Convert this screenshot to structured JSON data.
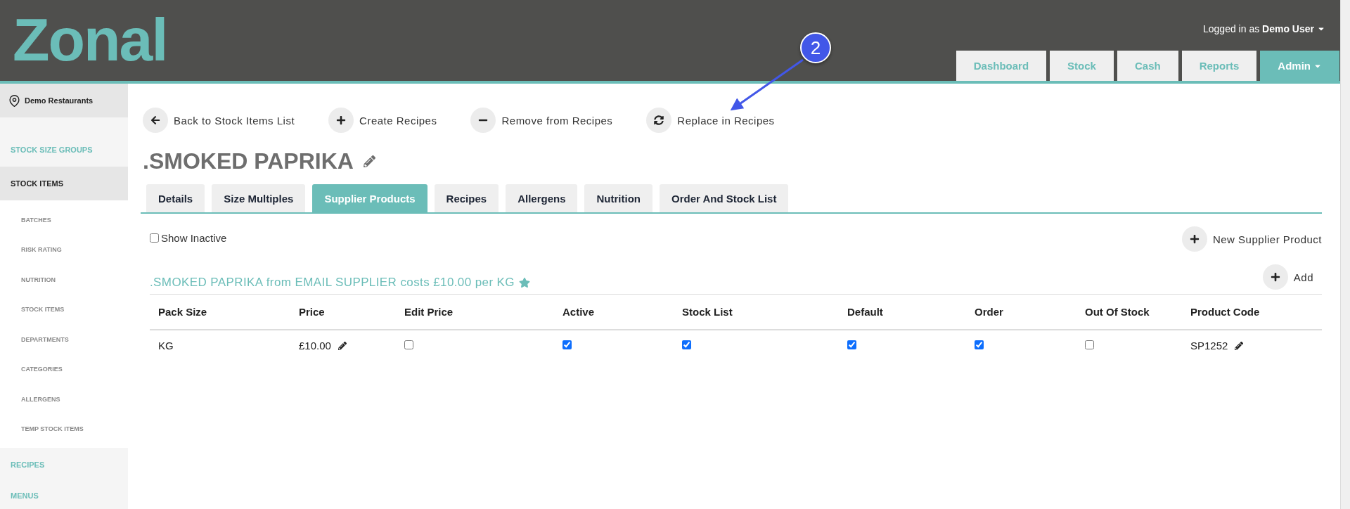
{
  "header": {
    "logo": "Zonal",
    "user_prefix": "Logged in as",
    "user_name": "Demo User",
    "nav": [
      {
        "label": "Dashboard",
        "selected": false,
        "dropdown": false
      },
      {
        "label": "Stock",
        "selected": false,
        "dropdown": false
      },
      {
        "label": "Cash",
        "selected": false,
        "dropdown": false
      },
      {
        "label": "Reports",
        "selected": false,
        "dropdown": false
      },
      {
        "label": "Admin",
        "selected": true,
        "dropdown": true
      }
    ]
  },
  "annotation": {
    "number": "2"
  },
  "sidebar": {
    "location": "Demo Restaurants",
    "items": [
      {
        "label": "STOCK SIZE GROUPS",
        "selected": false
      },
      {
        "label": "STOCK ITEMS",
        "selected": true,
        "children": [
          {
            "label": "BATCHES"
          },
          {
            "label": "RISK RATING"
          },
          {
            "label": "NUTRITION"
          },
          {
            "label": "STOCK ITEMS"
          },
          {
            "label": "DEPARTMENTS"
          },
          {
            "label": "CATEGORIES"
          },
          {
            "label": "ALLERGENS"
          },
          {
            "label": "TEMP STOCK ITEMS"
          }
        ]
      },
      {
        "label": "RECIPES",
        "selected": false
      },
      {
        "label": "MENUS",
        "selected": false
      }
    ]
  },
  "actions": [
    {
      "label": "Back to Stock Items List",
      "kind": "back"
    },
    {
      "label": "Create Recipes",
      "kind": "create"
    },
    {
      "label": "Remove from Recipes",
      "kind": "remove"
    },
    {
      "label": "Replace in Recipes",
      "kind": "replace"
    }
  ],
  "title": ".SMOKED PAPRIKA",
  "tabs": [
    {
      "label": "Details",
      "selected": false
    },
    {
      "label": "Size Multiples",
      "selected": false
    },
    {
      "label": "Supplier Products",
      "selected": true
    },
    {
      "label": "Recipes",
      "selected": false
    },
    {
      "label": "Allergens",
      "selected": false
    },
    {
      "label": "Nutrition",
      "selected": false
    },
    {
      "label": "Order And Stock List",
      "selected": false
    }
  ],
  "show_inactive": {
    "label": "Show Inactive",
    "checked": false
  },
  "new_product_button": "New Supplier Product",
  "supplier": {
    "summary": ".SMOKED PAPRIKA from EMAIL SUPPLIER costs £10.00 per KG",
    "default": true,
    "add_button": "Add",
    "table": {
      "columns": [
        "Pack Size",
        "Price",
        "Edit Price",
        "Active",
        "Stock List",
        "Default",
        "Order",
        "Out Of Stock",
        "Product Code"
      ],
      "rows": [
        {
          "pack_size": "KG",
          "price": "£10.00",
          "edit_price": false,
          "active": true,
          "stock_list": true,
          "default": true,
          "order": true,
          "out_of_stock": false,
          "product_code": "SP1252"
        }
      ]
    }
  }
}
